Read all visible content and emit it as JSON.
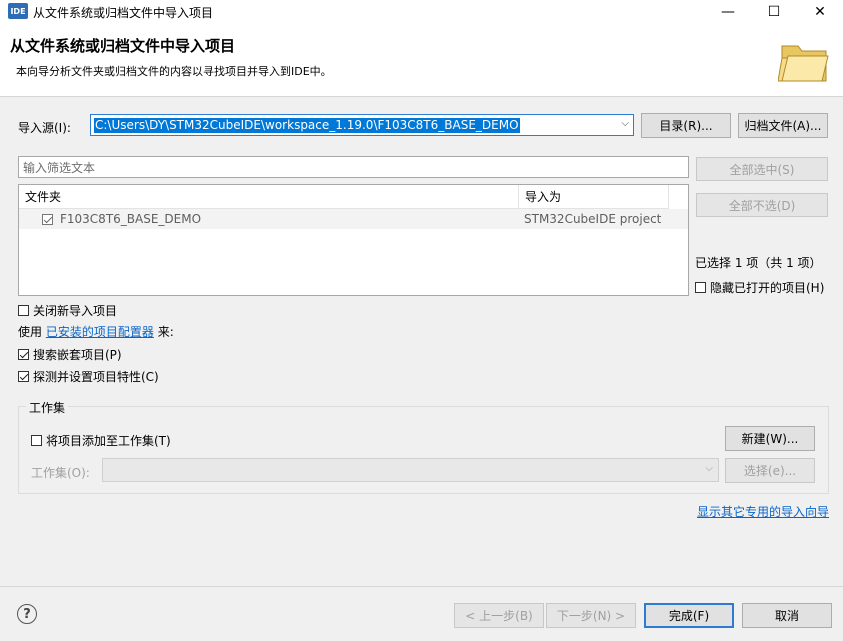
{
  "window": {
    "icon_text": "IDE",
    "title": "从文件系统或归档文件中导入项目",
    "minimize": "—",
    "maximize": "☐",
    "close": "✕"
  },
  "header": {
    "title": "从文件系统或归档文件中导入项目",
    "description": "本向导分析文件夹或归档文件的内容以寻找项目并导入到IDE中。"
  },
  "source": {
    "label": "导入源(I):",
    "value": "C:\\Users\\DY\\STM32CubeIDE\\workspace_1.19.0\\F103C8T6_BASE_DEMO",
    "directory_button": "目录(R)...",
    "archive_button": "归档文件(A)..."
  },
  "filter": {
    "placeholder": "输入筛选文本"
  },
  "table": {
    "columns": [
      "文件夹",
      "导入为"
    ],
    "rows": [
      {
        "folder": "F103C8T6_BASE_DEMO",
        "import_as": "STM32CubeIDE project",
        "checked": true
      }
    ]
  },
  "side": {
    "select_all": "全部选中(S)",
    "deselect_all": "全部不选(D)",
    "selection_status": "已选择 1 项（共 1 项）",
    "hide_open": "隐藏已打开的项目(H)"
  },
  "options": {
    "close_new": "关闭新导入项目",
    "use_prefix": "使用",
    "configurators_link": "已安装的项目配置器",
    "use_suffix": "来:",
    "search_nested": "搜索嵌套项目(P)",
    "detect_config": "探测并设置项目特性(C)"
  },
  "working_set": {
    "group_label": "工作集",
    "add_to": "将项目添加至工作集(T)",
    "new_button": "新建(W)...",
    "label": "工作集(O):",
    "select_button": "选择(e)..."
  },
  "other_wizards_link": "显示其它专用的导入向导",
  "footer": {
    "help": "?",
    "back": "< 上一步(B)",
    "next": "下一步(N) >",
    "finish": "完成(F)",
    "cancel": "取消"
  },
  "colors": {
    "accent": "#2f7bd3",
    "link": "#0a64c8",
    "selection": "#0078d7"
  }
}
